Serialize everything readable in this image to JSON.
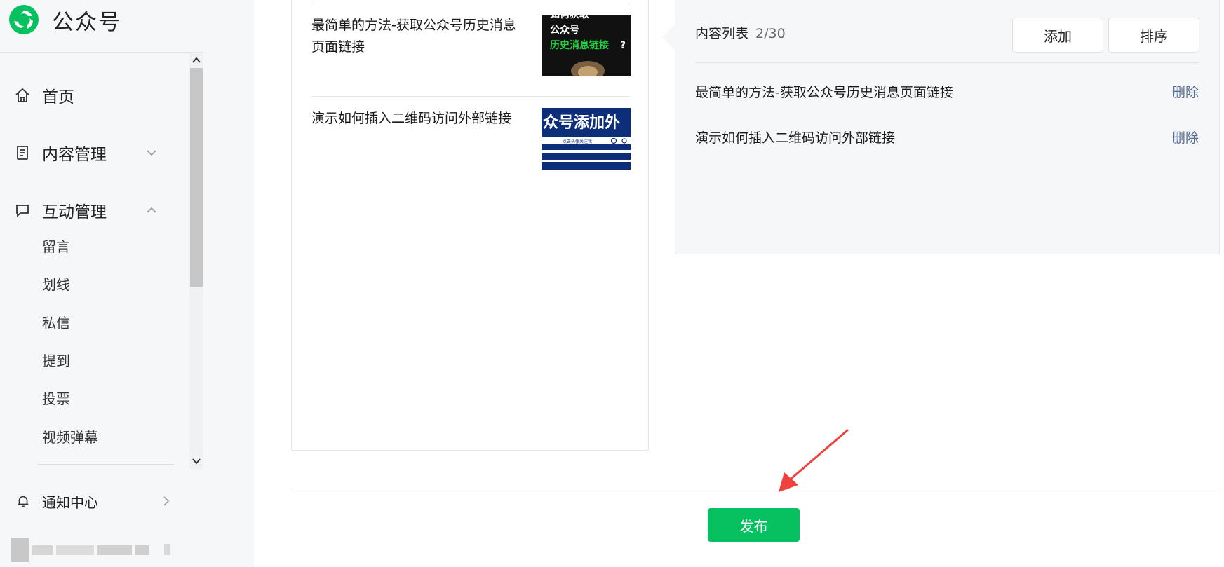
{
  "brand": {
    "name": "公众号"
  },
  "nav": {
    "home": "首页",
    "content": "内容管理",
    "interaction": "互动管理",
    "sub_items": [
      "留言",
      "划线",
      "私信",
      "提到",
      "投票",
      "视频弹幕"
    ],
    "notify": "通知中心"
  },
  "preview": {
    "articles": [
      {
        "title": "最简单的方法-获取公众号历史消息页面链接",
        "thumb_text": [
          "如何获取",
          "公众号",
          "历史消息链接",
          "?"
        ]
      },
      {
        "title": "演示如何插入二维码访问外部链接",
        "thumb_text": [
          "众号添加外",
          "点击头像关注我"
        ]
      }
    ]
  },
  "content_list": {
    "label": "内容列表",
    "count": "2/30",
    "add_label": "添加",
    "sort_label": "排序",
    "rows": [
      {
        "title": "最简单的方法-获取公众号历史消息页面链接",
        "action": "删除"
      },
      {
        "title": "演示如何插入二维码访问外部链接",
        "action": "删除"
      }
    ]
  },
  "footer": {
    "publish_label": "发布"
  },
  "colors": {
    "accent": "#07c160",
    "link": "#576b95",
    "annotation": "#f0413f"
  }
}
